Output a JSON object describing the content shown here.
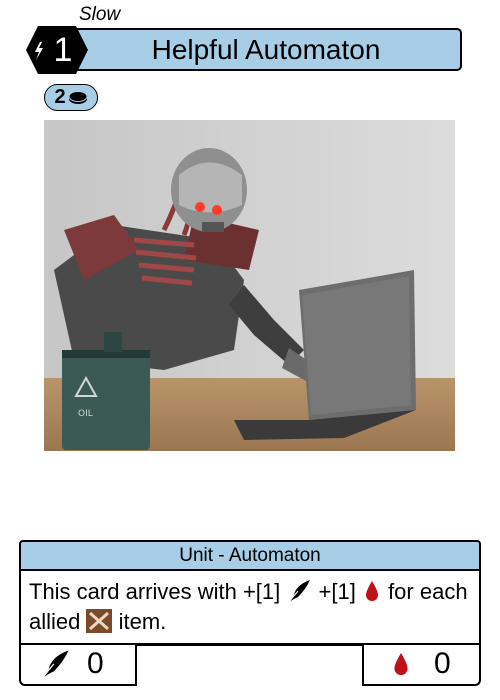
{
  "card": {
    "speed": "Slow",
    "cost": "1",
    "name": "Helpful Automaton",
    "price": "2",
    "type_line": "Unit - Automaton",
    "rules_text": {
      "part1": "This card arrives with +[1]",
      "part2": " +[1]",
      "part3": " for each allied ",
      "part4": " item."
    },
    "attack": "0",
    "health": "0"
  },
  "icons": {
    "cost": "lightning-hex-icon",
    "price": "coin-icon",
    "attack": "quill-icon",
    "health": "blood-drop-icon",
    "item": "crossed-swords-icon"
  },
  "colors": {
    "accent": "#a8cde6",
    "blood": "#c0101a",
    "item_bg": "#7a4a2a"
  },
  "art": {
    "subject": "robot-at-laptop-illustration"
  }
}
